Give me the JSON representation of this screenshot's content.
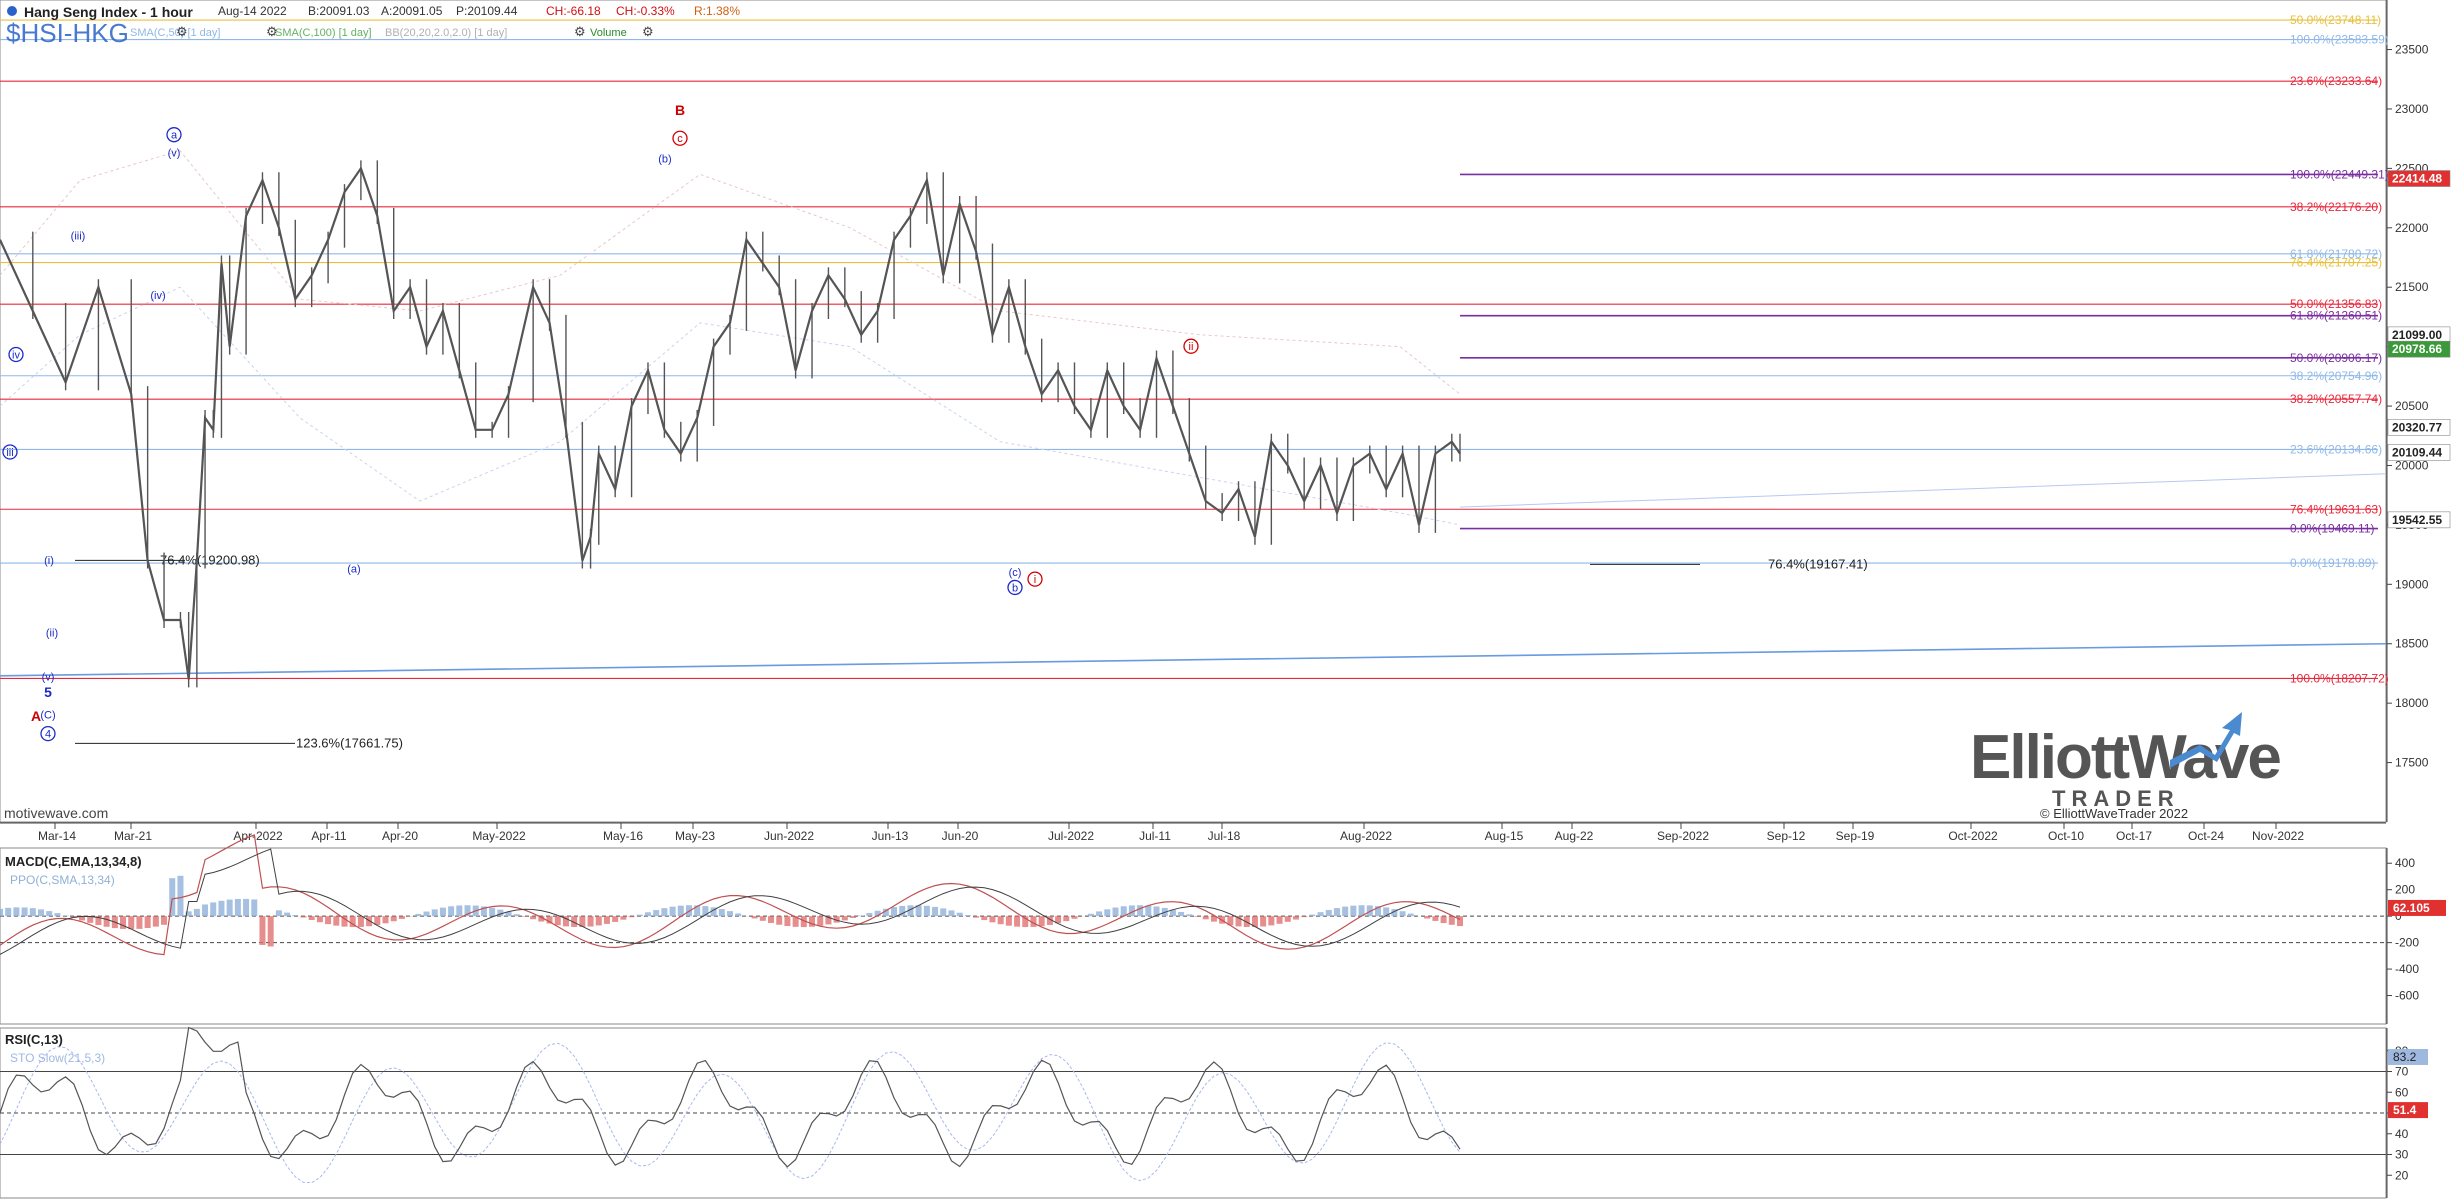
{
  "header": {
    "symbol": "Hang Seng Index - 1 hour",
    "date": "Aug-14 2022",
    "bid": "B:20091.03",
    "ask": "A:20091.05",
    "price": "P:20109.44",
    "change": "CH:-66.18",
    "change_pct": "CH:-0.33%",
    "range": "R:1.38%",
    "ticker": "$HSI-HKG",
    "study_sma50": "SMA(C,50) [1 day]",
    "study_sma100": "SMA(C,100) [1 day]",
    "study_bb": "BB(20,20,2.0,2.0) [1 day]",
    "study_volume": "Volume",
    "watermark": "motivewave.com",
    "copyright": "© ElliottWaveTrader 2022",
    "logo_main": "ElliottWave",
    "logo_sub": "TRADER"
  },
  "colors": {
    "price": "#555555",
    "fib_red": "#e8283c",
    "fib_blue": "#8fb8e8",
    "fib_purple": "#7a2fa0",
    "fib_orange": "#e8c040",
    "wave_blue": "#1a2bc8",
    "wave_red": "#d00000",
    "macd": "#c05050",
    "ppo_pos": "#8fb0d8",
    "ppo_neg": "#e07070"
  },
  "chart_data": [
    {
      "type": "line",
      "title": "Hang Seng Index - 1 hour",
      "ylim": [
        17000,
        23900
      ],
      "x_axis_labels": [
        "Mar-14",
        "Mar-21",
        "Apr-2022",
        "Apr-11",
        "Apr-20",
        "May-2022",
        "May-16",
        "May-23",
        "Jun-2022",
        "Jun-13",
        "Jun-20",
        "Jul-2022",
        "Jul-11",
        "Jul-18",
        "Aug-2022",
        "Aug-15",
        "Aug-22",
        "Sep-2022",
        "Sep-12",
        "Sep-19",
        "Oct-2022",
        "Oct-10",
        "Oct-17",
        "Oct-24",
        "Nov-2022"
      ],
      "y_ticks": [
        17500,
        18000,
        18500,
        19000,
        19500,
        20000,
        20500,
        21000,
        21500,
        22000,
        22500,
        23000,
        23500
      ],
      "price_path": [
        [
          0,
          21900
        ],
        [
          4,
          21300
        ],
        [
          8,
          20700
        ],
        [
          12,
          21500
        ],
        [
          16,
          20600
        ],
        [
          18,
          19200
        ],
        [
          20,
          18700
        ],
        [
          22,
          18700
        ],
        [
          23,
          18200
        ],
        [
          24,
          19200
        ],
        [
          25,
          20400
        ],
        [
          26,
          20300
        ],
        [
          27,
          21700
        ],
        [
          28,
          21000
        ],
        [
          30,
          22100
        ],
        [
          32,
          22400
        ],
        [
          34,
          22000
        ],
        [
          36,
          21400
        ],
        [
          38,
          21600
        ],
        [
          40,
          21900
        ],
        [
          42,
          22300
        ],
        [
          44,
          22500
        ],
        [
          46,
          22100
        ],
        [
          48,
          21300
        ],
        [
          50,
          21500
        ],
        [
          52,
          21000
        ],
        [
          54,
          21300
        ],
        [
          56,
          20800
        ],
        [
          58,
          20300
        ],
        [
          60,
          20300
        ],
        [
          62,
          20600
        ],
        [
          65,
          21500
        ],
        [
          67,
          21200
        ],
        [
          69,
          20300
        ],
        [
          71,
          19200
        ],
        [
          72,
          19400
        ],
        [
          73,
          20100
        ],
        [
          75,
          19800
        ],
        [
          77,
          20500
        ],
        [
          79,
          20800
        ],
        [
          81,
          20300
        ],
        [
          83,
          20100
        ],
        [
          85,
          20400
        ],
        [
          87,
          21000
        ],
        [
          89,
          21200
        ],
        [
          91,
          21900
        ],
        [
          93,
          21700
        ],
        [
          95,
          21500
        ],
        [
          97,
          20800
        ],
        [
          99,
          21300
        ],
        [
          101,
          21600
        ],
        [
          103,
          21400
        ],
        [
          105,
          21100
        ],
        [
          107,
          21300
        ],
        [
          109,
          21900
        ],
        [
          111,
          22100
        ],
        [
          113,
          22400
        ],
        [
          115,
          21600
        ],
        [
          117,
          22200
        ],
        [
          119,
          21800
        ],
        [
          121,
          21100
        ],
        [
          123,
          21500
        ],
        [
          125,
          21000
        ],
        [
          127,
          20600
        ],
        [
          129,
          20800
        ],
        [
          131,
          20500
        ],
        [
          133,
          20300
        ],
        [
          135,
          20800
        ],
        [
          137,
          20500
        ],
        [
          139,
          20300
        ],
        [
          141,
          20900
        ],
        [
          143,
          20500
        ],
        [
          145,
          20100
        ],
        [
          147,
          19700
        ],
        [
          149,
          19600
        ],
        [
          151,
          19800
        ],
        [
          153,
          19400
        ],
        [
          155,
          20200
        ],
        [
          157,
          20000
        ],
        [
          159,
          19700
        ],
        [
          161,
          20000
        ],
        [
          163,
          19600
        ],
        [
          165,
          20000
        ],
        [
          167,
          20100
        ],
        [
          169,
          19800
        ],
        [
          171,
          20100
        ],
        [
          173,
          19500
        ],
        [
          175,
          20100
        ],
        [
          177,
          20200
        ],
        [
          178,
          20100
        ]
      ],
      "fib_levels": [
        {
          "label": "50.0%(23748.11)",
          "value": 23748.11,
          "color": "orange"
        },
        {
          "label": "100.0%(23583.59)",
          "value": 23583.59,
          "color": "blue"
        },
        {
          "label": "23.6%(23233.64)",
          "value": 23233.64,
          "color": "red"
        },
        {
          "label": "100.0%(22449.31)",
          "value": 22449.31,
          "color": "purple"
        },
        {
          "label": "38.2%(22176.20)",
          "value": 22176.2,
          "color": "red"
        },
        {
          "label": "61.8%(21780.72)",
          "value": 21780.72,
          "color": "blue"
        },
        {
          "label": "76.4%(21707.25)",
          "value": 21707.25,
          "color": "orange"
        },
        {
          "label": "50.0%(21356.83)",
          "value": 21356.83,
          "color": "red"
        },
        {
          "label": "61.8%(21260.51)",
          "value": 21260.51,
          "color": "purple"
        },
        {
          "label": "50.0%(20906.17)",
          "value": 20906.17,
          "color": "purple"
        },
        {
          "label": "38.2%(20754.96)",
          "value": 20754.96,
          "color": "blue"
        },
        {
          "label": "38.2%(20557.74)",
          "value": 20557.74,
          "color": "red"
        },
        {
          "label": "23.6%(20134.66)",
          "value": 20134.66,
          "color": "blue"
        },
        {
          "label": "76.4%(19631.63)",
          "value": 19631.63,
          "color": "red"
        },
        {
          "label": "0.0%(19469.11)",
          "value": 19469.11,
          "color": "purple"
        },
        {
          "label": "0.0%(19178.89)",
          "value": 19178.89,
          "color": "blue"
        },
        {
          "label": "100.0%(18207.72)",
          "value": 18207.72,
          "color": "red"
        }
      ],
      "projection_labels": [
        {
          "label": "76.4%(19200.98)",
          "value": 19200.98
        },
        {
          "label": "123.6%(17661.75)",
          "value": 17661.75
        },
        {
          "label": "76.4%(19167.41)",
          "value": 19167.41
        }
      ],
      "price_boxes": [
        {
          "label": "22414.48",
          "value": 22414.48,
          "bg": "#e03030"
        },
        {
          "label": "21099.00",
          "value": 21099.0,
          "bg": "#ffffff"
        },
        {
          "label": "20978.66",
          "value": 20978.66,
          "bg": "#3a9a3a"
        },
        {
          "label": "20320.77",
          "value": 20320.77,
          "bg": "#ffffff"
        },
        {
          "label": "20109.44",
          "value": 20109.44,
          "bg": "#ffffff"
        },
        {
          "label": "19542.55",
          "value": 19542.55,
          "bg": "#ffffff"
        }
      ],
      "wave_labels": [
        {
          "text": "iv",
          "x": 16,
          "y": 20900,
          "color": "blue",
          "circle": true
        },
        {
          "text": "iii",
          "x": 10,
          "y": 20080,
          "color": "blue",
          "circle": true
        },
        {
          "text": "(iii)",
          "x": 78,
          "y": 21900,
          "color": "blue",
          "circle": false
        },
        {
          "text": "a",
          "x": 174,
          "y": 22750,
          "color": "blue",
          "circle": true
        },
        {
          "text": "(v)",
          "x": 174,
          "y": 22600,
          "color": "blue",
          "circle": false
        },
        {
          "text": "(iv)",
          "x": 158,
          "y": 21400,
          "color": "blue",
          "circle": false
        },
        {
          "text": "(i)",
          "x": 49,
          "y": 19170,
          "color": "blue",
          "circle": false
        },
        {
          "text": "(ii)",
          "x": 52,
          "y": 18560,
          "color": "blue",
          "circle": false
        },
        {
          "text": "(v)",
          "x": 48,
          "y": 18190,
          "color": "blue",
          "circle": false
        },
        {
          "text": "5",
          "x": 48,
          "y": 18050,
          "color": "blue",
          "circle": false
        },
        {
          "text": "A",
          "x": 36,
          "y": 17850,
          "color": "red",
          "circle": false
        },
        {
          "text": "(C)",
          "x": 48,
          "y": 17870,
          "color": "blue",
          "circle": false
        },
        {
          "text": "4",
          "x": 48,
          "y": 17710,
          "color": "blue",
          "circle": true
        },
        {
          "text": "(a)",
          "x": 354,
          "y": 19100,
          "color": "blue",
          "circle": false
        },
        {
          "text": "B",
          "x": 680,
          "y": 22950,
          "color": "red",
          "circle": false
        },
        {
          "text": "c",
          "x": 680,
          "y": 22720,
          "color": "red",
          "circle": true
        },
        {
          "text": "(b)",
          "x": 665,
          "y": 22550,
          "color": "blue",
          "circle": false
        },
        {
          "text": "ii",
          "x": 1191,
          "y": 20970,
          "color": "red",
          "circle": true
        },
        {
          "text": "(c)",
          "x": 1015,
          "y": 19070,
          "color": "blue",
          "circle": false
        },
        {
          "text": "b",
          "x": 1015,
          "y": 18940,
          "color": "blue",
          "circle": true
        },
        {
          "text": "i",
          "x": 1035,
          "y": 19010,
          "color": "red",
          "circle": true
        }
      ]
    },
    {
      "type": "line",
      "title": "MACD(C,EMA,13,34,8)",
      "secondary_label": "PPO(C,SMA,13,34)",
      "ylim": [
        -800,
        500
      ],
      "y_ticks": [
        400,
        200,
        0,
        -200,
        -400,
        -600
      ],
      "last_value": "62.105"
    },
    {
      "type": "line",
      "title": "RSI(C,13)",
      "secondary_label": "STO Slow(21,5,3)",
      "ylim": [
        10,
        90
      ],
      "y_ticks": [
        80,
        70,
        60,
        50,
        40,
        30,
        20
      ],
      "last_value_1": "83.2",
      "last_value_2": "51.4"
    }
  ]
}
